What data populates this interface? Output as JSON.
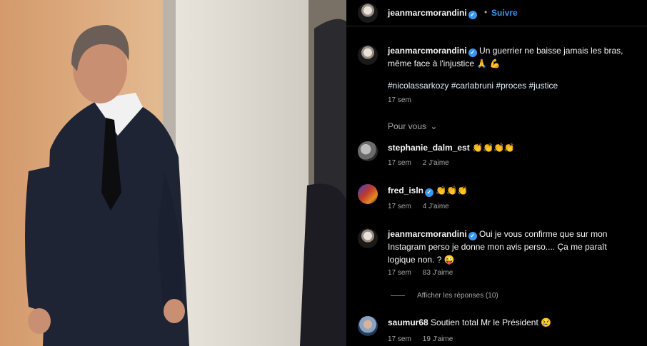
{
  "post": {
    "author": "jeanmarcmorandini",
    "follow_label": "Suivre",
    "caption": "Un guerrier ne baisse jamais les bras, même face à l'injustice 🙏 💪",
    "hashtags": [
      "#nicolassarkozy",
      "#carlabruni",
      "#proces",
      "#justice"
    ],
    "time": "17 sem"
  },
  "pour_vous_label": "Pour vous",
  "comments": [
    {
      "user": "stephanie_dalm_est",
      "text": "👏👏👏👏",
      "time": "17 sem",
      "likes": "2 J'aime",
      "verified": false
    },
    {
      "user": "fred_isln",
      "text": "👏👏👏",
      "time": "17 sem",
      "likes": "4 J'aime",
      "verified": true
    },
    {
      "user": "jeanmarcmorandini",
      "text": "Oui je vous confirme que sur mon Instagram perso je donne mon avis perso.... Ça me paraît logique non. ? 😜",
      "time": "17 sem",
      "likes": "83 J'aime",
      "verified": true,
      "replies_label": "Afficher les réponses (10)"
    },
    {
      "user": "saumur68",
      "text": "Soutien total Mr le Président 😢",
      "time": "17 sem",
      "likes": "19 J'aime",
      "verified": false
    }
  ],
  "colors": {
    "link": "#3897f0",
    "verified": "#3897f0",
    "muted": "#a8a8a8",
    "background": "#000000"
  },
  "icons": [
    "verified-badge-icon",
    "chevron-down-icon"
  ]
}
